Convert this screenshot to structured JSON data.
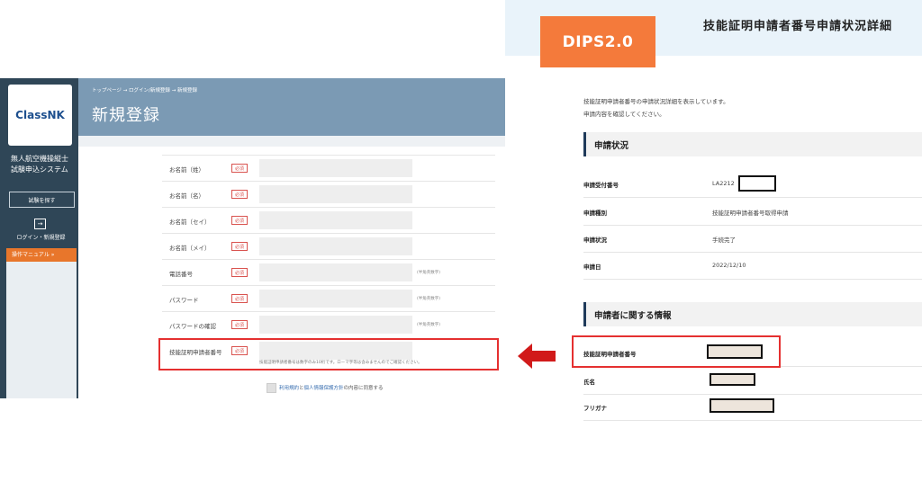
{
  "left": {
    "logo_text": "ClassNK",
    "system_title": "無人航空機操縦士試験申込システム",
    "search_button": "試験を探す",
    "login_icon": "→",
    "login_label": "ログイン・新規登録",
    "manual_button": "操作マニュアル »",
    "breadcrumb": "トップページ → ログイン/新規登録 → 新規登録",
    "page_title": "新規登録",
    "required_badge": "必須",
    "fields": [
      {
        "label": "お名前（姓）",
        "hint": ""
      },
      {
        "label": "お名前（名）",
        "hint": ""
      },
      {
        "label": "お名前（セイ）",
        "hint": ""
      },
      {
        "label": "お名前（メイ）",
        "hint": ""
      },
      {
        "label": "電話番号",
        "hint": "(半角英数字)"
      },
      {
        "label": "パスワード",
        "hint": "(半角英数字)"
      },
      {
        "label": "パスワードの確認",
        "hint": "(半角英数字)"
      },
      {
        "label": "技能証明申請者番号",
        "hint": ""
      }
    ],
    "cert_note": "技能証明申請者番号は数字のみ10桁です。ローマ字等は含みませんのでご確認ください。",
    "agree_link1": "利用規約",
    "agree_mid": "と",
    "agree_link2": "個人情報保護方針",
    "agree_tail": "の内容に同意する"
  },
  "right": {
    "badge": "DIPS2.0",
    "title": "技能証明申請者番号申請状況詳細",
    "intro_line1": "技能証明申請者番号の申請状況詳細を表示しています。",
    "intro_line2": "申請内容を確認してください。",
    "section1": "申請状況",
    "rows1": [
      {
        "label": "申請受付番号",
        "value": "LA2212"
      },
      {
        "label": "申請種別",
        "value": "技能証明申請者番号取得申請"
      },
      {
        "label": "申請状況",
        "value": "手続完了"
      },
      {
        "label": "申請日",
        "value": "2022/12/10"
      }
    ],
    "section2": "申請者に関する情報",
    "rows2": [
      {
        "label": "技能証明申請者番号",
        "value": ""
      },
      {
        "label": "氏名",
        "value": ""
      },
      {
        "label": "フリガナ",
        "value": ""
      }
    ]
  },
  "colors": {
    "accent_orange": "#f47a3b",
    "highlight_red": "#e53030",
    "header_blue": "#7b9ab4",
    "sidebar_navy": "#2f4657"
  },
  "icons": {
    "arrow": "left-arrow-icon",
    "login": "login-icon"
  }
}
